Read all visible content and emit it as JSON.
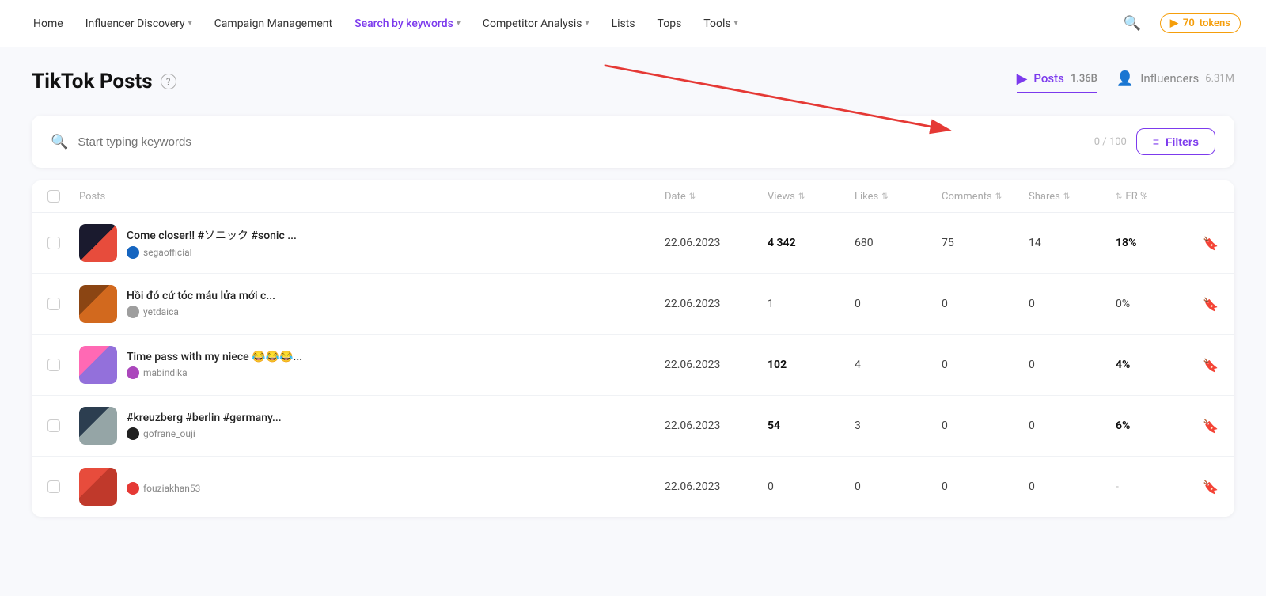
{
  "nav": {
    "home": "Home",
    "influencer_discovery": "Influencer Discovery",
    "campaign_management": "Campaign Management",
    "search_by_keywords": "Search by keywords",
    "competitor_analysis": "Competitor Analysis",
    "lists": "Lists",
    "tops": "Tops",
    "tools": "Tools",
    "tokens_count": "70",
    "tokens_label": "tokens"
  },
  "page": {
    "title": "TikTok Posts",
    "help_icon": "?",
    "tabs": [
      {
        "id": "posts",
        "icon": "▶",
        "label": "Posts",
        "count": "1.36B",
        "active": true
      },
      {
        "id": "influencers",
        "icon": "👤",
        "label": "Influencers",
        "count": "6.31M",
        "active": false
      }
    ]
  },
  "search": {
    "placeholder": "Start typing keywords",
    "count": "0 / 100",
    "filters_label": "Filters"
  },
  "table": {
    "headers": [
      {
        "id": "checkbox",
        "label": ""
      },
      {
        "id": "posts",
        "label": "Posts",
        "sortable": false
      },
      {
        "id": "date",
        "label": "Date",
        "sortable": true
      },
      {
        "id": "views",
        "label": "Views",
        "sortable": true
      },
      {
        "id": "likes",
        "label": "Likes",
        "sortable": true
      },
      {
        "id": "comments",
        "label": "Comments",
        "sortable": true
      },
      {
        "id": "shares",
        "label": "Shares",
        "sortable": true
      },
      {
        "id": "er",
        "label": "ER %",
        "sortable": true
      },
      {
        "id": "bookmark",
        "label": ""
      }
    ],
    "rows": [
      {
        "id": 1,
        "title": "Come closer!! #ソニック #sonic ...",
        "author": "segaofficial",
        "thumb_class": "thumb-sega",
        "avatar_class": "avatar-sega",
        "date": "22.06.2023",
        "views": "4 342",
        "views_bold": true,
        "likes": "680",
        "likes_bold": false,
        "comments": "75",
        "shares": "14",
        "er": "18%",
        "er_bold": true
      },
      {
        "id": 2,
        "title": "Hồi đó cứ tóc máu lửa mới c...",
        "author": "yetdaica",
        "thumb_class": "thumb-hair",
        "avatar_class": "avatar-yet",
        "date": "22.06.2023",
        "views": "1",
        "views_bold": false,
        "likes": "0",
        "likes_bold": false,
        "comments": "0",
        "shares": "0",
        "er": "0%",
        "er_bold": false
      },
      {
        "id": 3,
        "title": "Time pass with my niece 😂😂😂...",
        "author": "mabindika",
        "thumb_class": "thumb-niece",
        "avatar_class": "avatar-mab",
        "date": "22.06.2023",
        "views": "102",
        "views_bold": true,
        "likes": "4",
        "likes_bold": false,
        "comments": "0",
        "shares": "0",
        "er": "4%",
        "er_bold": true
      },
      {
        "id": 4,
        "title": "#kreuzberg #berlin #germany...",
        "author": "gofrane_ouji",
        "thumb_class": "thumb-berlin",
        "avatar_class": "avatar-gof",
        "date": "22.06.2023",
        "views": "54",
        "views_bold": true,
        "likes": "3",
        "likes_bold": false,
        "comments": "0",
        "shares": "0",
        "er": "6%",
        "er_bold": true
      },
      {
        "id": 5,
        "title": "",
        "author": "fouziakhan53",
        "thumb_class": "thumb-fouzia",
        "avatar_class": "avatar-fou",
        "date": "22.06.2023",
        "views": "0",
        "views_bold": false,
        "likes": "0",
        "likes_bold": false,
        "comments": "0",
        "shares": "0",
        "er": "-",
        "er_bold": false
      }
    ]
  },
  "arrow": {
    "description": "Red arrow pointing from Search by keywords nav item to Posts tab"
  }
}
